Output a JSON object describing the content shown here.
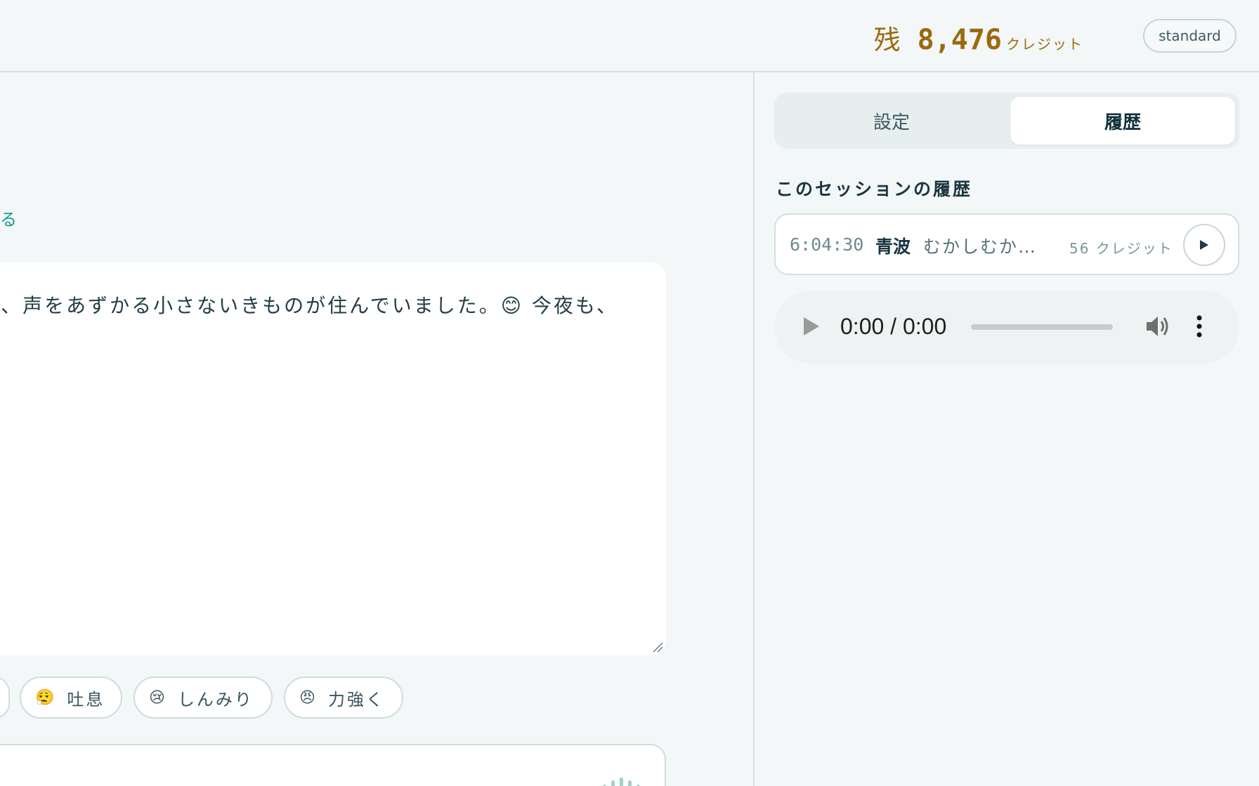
{
  "header": {
    "credit_prefix": "残",
    "credit_amount": "8,476",
    "credit_unit": "クレジット",
    "plan": "standard"
  },
  "editor": {
    "link_fragment": "る",
    "text": "に、声をあずかる小さないきものが住んでいました。😊 今夜も、"
  },
  "chips": [
    {
      "emoji": "😮‍💨",
      "label": "吐息"
    },
    {
      "emoji": "😢",
      "label": "しんみり"
    },
    {
      "emoji": "😠",
      "label": "力強く"
    }
  ],
  "right_panel": {
    "tabs": [
      {
        "label": "設定",
        "active": false
      },
      {
        "label": "履歴",
        "active": true
      }
    ],
    "section_title": "このセッションの履歴",
    "history": [
      {
        "time": "6:04:30",
        "voice": "青波",
        "text": "むかしむかし…",
        "credits": "56 クレジット"
      }
    ],
    "audio_player": {
      "time": "0:00 / 0:00",
      "progress": 0
    }
  },
  "colors": {
    "accent_teal": "#139b8a",
    "credit_gold": "#9a6a10",
    "background": "#f3f7f7"
  }
}
